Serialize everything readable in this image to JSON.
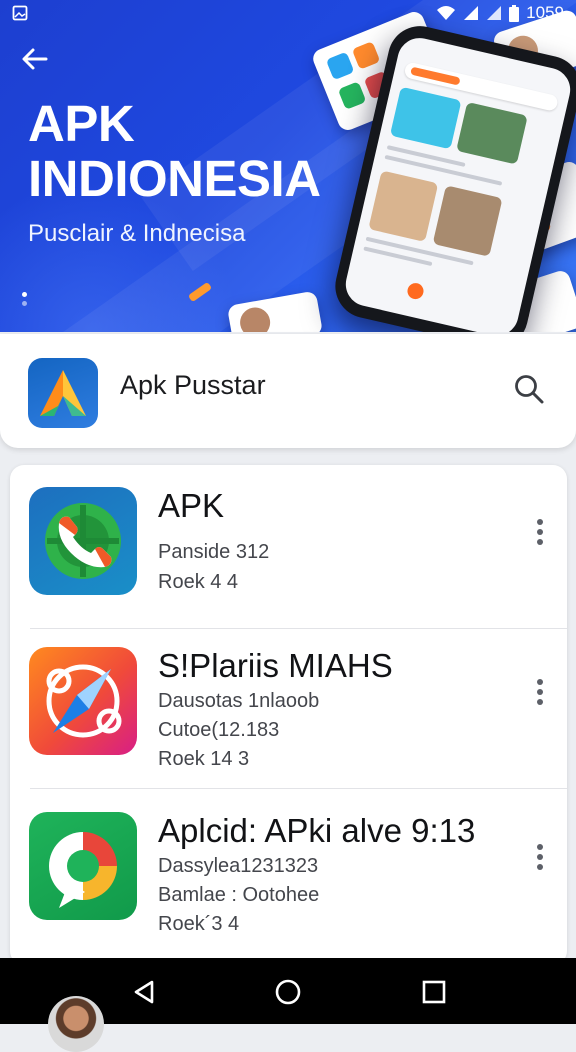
{
  "status_bar": {
    "time": "1059",
    "icons": [
      "image-icon",
      "wifi-icon",
      "signal-icon",
      "signal-icon",
      "battery-icon"
    ]
  },
  "hero": {
    "title": "APK INDIONESIA",
    "subtitle": "Pusclair &  Indnecisa",
    "back_icon": "back-arrow-icon"
  },
  "search_card": {
    "title": "Apk Pusstar",
    "search_icon": "search-icon"
  },
  "apps": [
    {
      "name": "APK",
      "meta": [
        "Panside 312",
        "Roek  4 4"
      ],
      "icon": "phone-app-icon"
    },
    {
      "name": "S!Plariis MIAHS",
      "meta": [
        "Dausotas 1nlaoob",
        "Cutoe(12.183",
        "Roek 14 3"
      ],
      "icon": "compass-app-icon"
    },
    {
      "name": "Aplcid: APki alve 9:13",
      "meta": [
        "Dassylea1231323",
        "Bamlae : Ootohee",
        "Roek´3 4"
      ],
      "icon": "chrome-app-icon"
    }
  ],
  "navbar": {
    "back": "nav-back-icon",
    "home": "nav-home-icon",
    "recents": "nav-recents-icon"
  },
  "colors": {
    "hero": "#1f49e0",
    "accent": "#ff6a1f",
    "text": "#121316"
  }
}
